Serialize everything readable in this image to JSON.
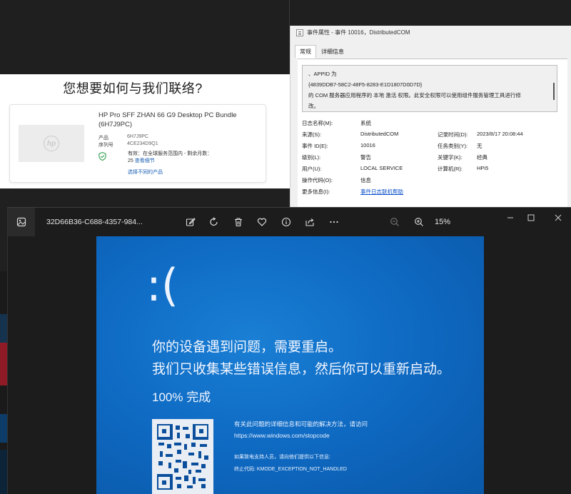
{
  "hp_page": {
    "heading": "您想要如何与我们联络?",
    "logo_text": "hp",
    "product_title": "HP Pro SFF ZHAN 66 G9 Desktop PC Bundle (6H7J9PC)",
    "product_label": "产品",
    "product_value": "6H7J9PC",
    "serial_label": "序列号",
    "serial_value": "4CE234D9Q1",
    "warranty_text": "有效：在全球服务范围内 - 剩余月数：",
    "warranty_months": "25",
    "view_details": "查看细节",
    "choose_other": "选择不同的产品"
  },
  "event_dialog": {
    "title": "事件属性 - 事件 10016，DistributedCOM",
    "tabs": [
      "常规",
      "详细信息"
    ],
    "desc_lines": [
      "、APPID 为",
      "{4839DDB7-58C2-48F5-8283-E1D1807D0D7D}",
      "的 COM 服务器应用程序的 本地 激活 权限。此安全权限可以使用组件服务管理工具进行修",
      "改。"
    ],
    "log_name_label": "日志名称(M):",
    "log_name": "系统",
    "source_label": "来源(S):",
    "source": "DistributedCOM",
    "logged_label": "记录时间(D):",
    "logged": "2023/8/17 20:08:44",
    "event_id_label": "事件 ID(E):",
    "event_id": "10016",
    "task_label": "任务类别(Y):",
    "task": "无",
    "level_label": "级别(L):",
    "level": "警告",
    "keywords_label": "关键字(K):",
    "keywords": "经典",
    "user_label": "用户(U):",
    "user": "LOCAL SERVICE",
    "computer_label": "计算机(R):",
    "computer": "HPi5",
    "opcode_label": "操作代码(O):",
    "opcode": "信息",
    "more_label": "更多信息(I):",
    "more_link": "事件日志联机帮助"
  },
  "photos": {
    "filename": "32D66B36-C688-4357-984...",
    "zoom": "15%",
    "toolbar_icons": [
      "edit-icon",
      "rotate-icon",
      "delete-icon",
      "favorite-icon",
      "info-icon",
      "share-icon",
      "more-icon"
    ]
  },
  "bsod": {
    "face": ":(",
    "line1": "你的设备遇到问题，需要重启。",
    "line2": "我们只收集某些错误信息，然后你可以重新启动。",
    "progress": "100% 完成",
    "progress_value": 100,
    "info1": "有关此问题的详细信息和可能的解决方法，请访问",
    "url": "https://www.windows.com/stopcode",
    "support": "如果致电支持人员，请向他们提供以下信息:",
    "stop_code": "终止代码: KMODE_EXCEPTION_NOT_HANDLED"
  },
  "colors": {
    "bsod_blue": "#0f6bc4",
    "link_blue": "#1a5fb4",
    "dark_bg": "#1c1c1c"
  }
}
